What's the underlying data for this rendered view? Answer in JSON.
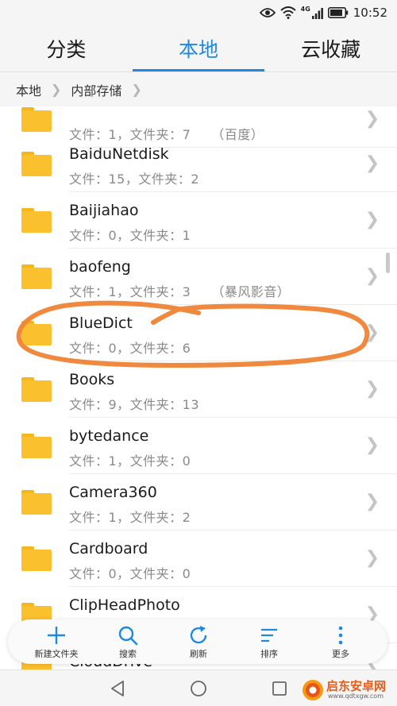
{
  "status_bar": {
    "time": "10:52",
    "network": "4G",
    "icons": [
      "eye-icon",
      "wifi-icon",
      "signal-icon",
      "battery-icon"
    ]
  },
  "tabs": [
    {
      "label": "分类",
      "active": false
    },
    {
      "label": "本地",
      "active": true
    },
    {
      "label": "云收藏",
      "active": false
    }
  ],
  "breadcrumb": [
    "本地",
    "内部存储"
  ],
  "folders": [
    {
      "name": "",
      "meta": "文件：1，文件夹：7",
      "note": "（百度）"
    },
    {
      "name": "BaiduNetdisk",
      "meta": "文件：15，文件夹：2",
      "note": ""
    },
    {
      "name": "Baijiahao",
      "meta": "文件：0，文件夹：1",
      "note": ""
    },
    {
      "name": "baofeng",
      "meta": "文件：1，文件夹：3",
      "note": "（暴风影音）"
    },
    {
      "name": "BlueDict",
      "meta": "文件：0，文件夹：6",
      "note": ""
    },
    {
      "name": "Books",
      "meta": "文件：9，文件夹：13",
      "note": ""
    },
    {
      "name": "bytedance",
      "meta": "文件：1，文件夹：0",
      "note": ""
    },
    {
      "name": "Camera360",
      "meta": "文件：1，文件夹：2",
      "note": ""
    },
    {
      "name": "Cardboard",
      "meta": "文件：0，文件夹：0",
      "note": ""
    },
    {
      "name": "ClipHeadPhoto",
      "meta": "",
      "note": ""
    },
    {
      "name": "CloudDrive",
      "meta": "",
      "note": ""
    }
  ],
  "toolbar": [
    {
      "label": "新建文件夹",
      "icon": "plus-icon"
    },
    {
      "label": "搜索",
      "icon": "search-icon"
    },
    {
      "label": "刷新",
      "icon": "refresh-icon"
    },
    {
      "label": "排序",
      "icon": "sort-icon"
    },
    {
      "label": "更多",
      "icon": "more-icon"
    }
  ],
  "annotation": {
    "color": "#f0883e",
    "highlighted": "BlueDict"
  },
  "watermark": {
    "text": "启东安卓网",
    "url": "www.qdtxgw.com"
  },
  "colors": {
    "accent": "#1e88e5",
    "folder": "#fbc02d",
    "annotation": "#f0883e"
  }
}
